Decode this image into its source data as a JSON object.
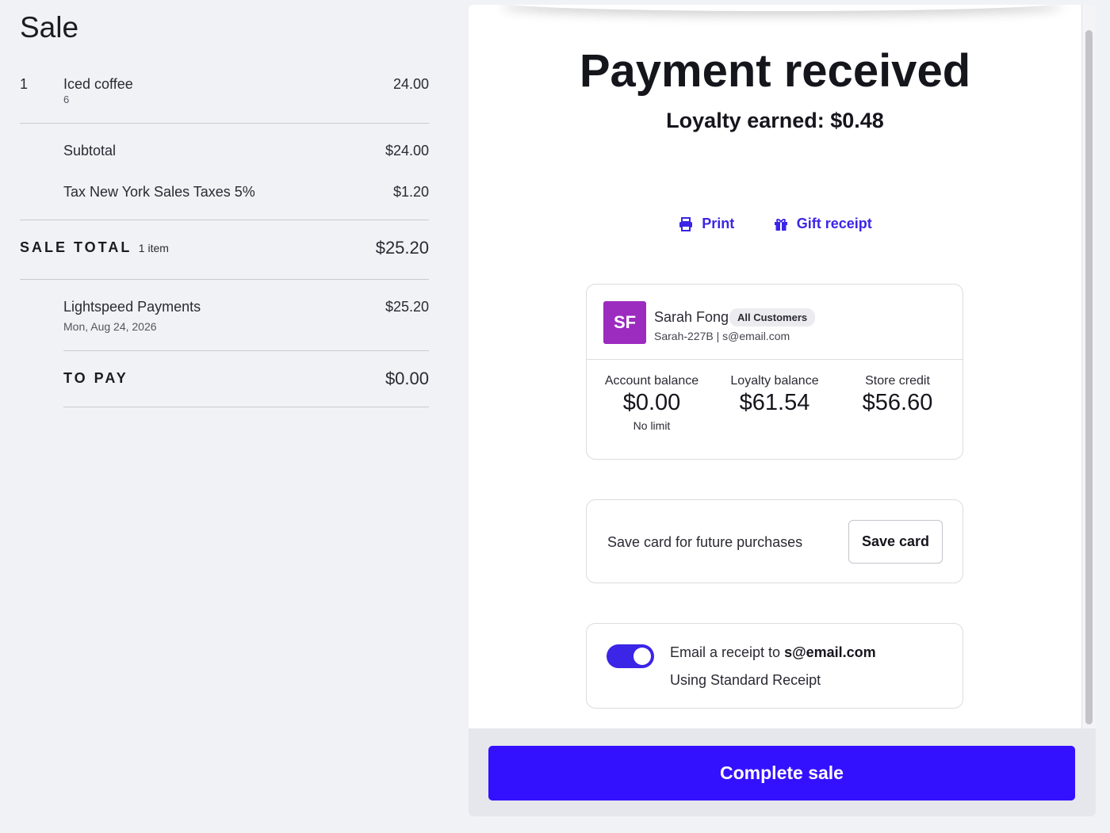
{
  "sale": {
    "title": "Sale",
    "line_items": [
      {
        "qty": "1",
        "name": "Iced coffee",
        "sub": "6",
        "price": "24.00"
      }
    ],
    "subtotal_label": "Subtotal",
    "subtotal_value": "$24.00",
    "tax_label": "Tax New York Sales Taxes 5%",
    "tax_value": "$1.20",
    "total_label": "SALE TOTAL",
    "total_items": "1 item",
    "total_value": "$25.20",
    "payment": {
      "name": "Lightspeed Payments",
      "date": "Mon, Aug 24, 2026",
      "amount": "$25.20"
    },
    "to_pay_label": "TO PAY",
    "to_pay_value": "$0.00"
  },
  "payment_panel": {
    "title": "Payment received",
    "loyalty_earned": "Loyalty earned: $0.48",
    "print_label": "Print",
    "gift_receipt_label": "Gift receipt"
  },
  "customer": {
    "initials": "SF",
    "name": "Sarah Fong",
    "group": "All Customers",
    "meta": "Sarah-227B | s@email.com",
    "account_balance_label": "Account balance",
    "account_balance_value": "$0.00",
    "account_balance_note": "No limit",
    "loyalty_balance_label": "Loyalty balance",
    "loyalty_balance_value": "$61.54",
    "store_credit_label": "Store credit",
    "store_credit_value": "$56.60"
  },
  "save_card": {
    "text": "Save card for future purchases",
    "button": "Save card"
  },
  "email_receipt": {
    "prefix": "Email a receipt to ",
    "email": "s@email.com",
    "template": "Using Standard Receipt",
    "enabled": true
  },
  "complete_sale_label": "Complete sale",
  "colors": {
    "accent": "#3311ff",
    "link": "#3b25e6",
    "avatar": "#9c2bc0"
  }
}
